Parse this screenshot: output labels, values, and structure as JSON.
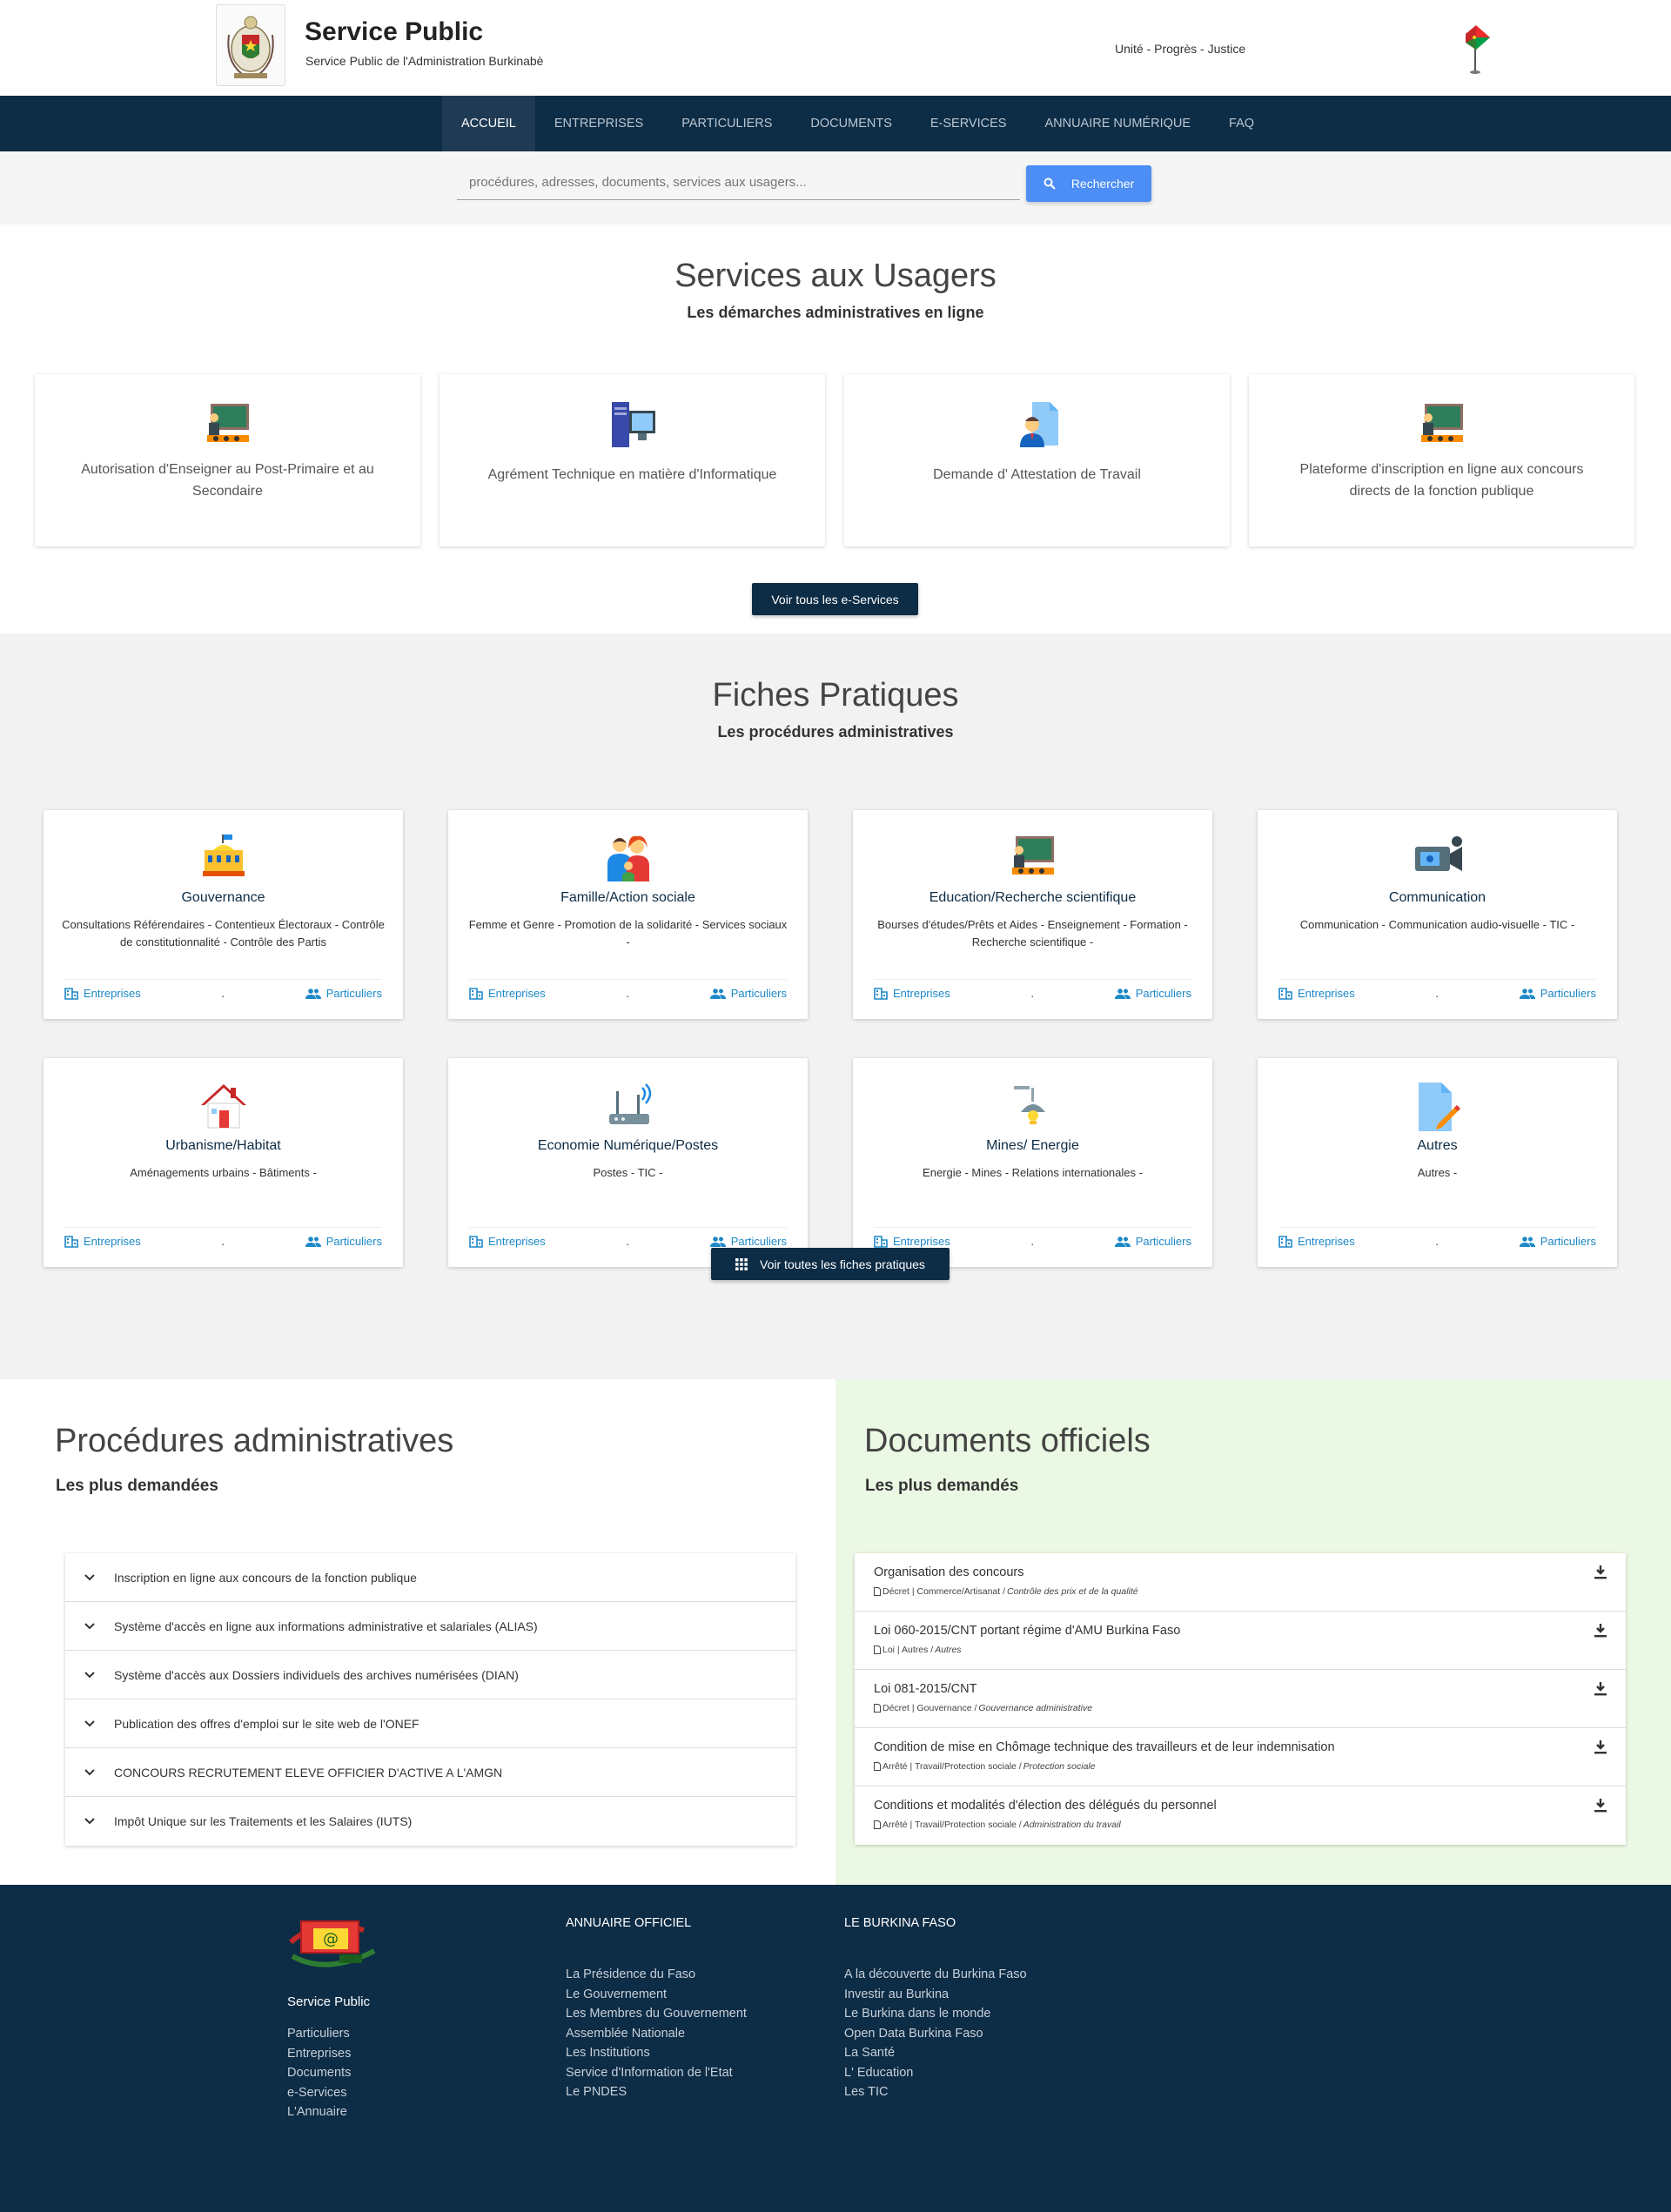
{
  "header": {
    "title": "Service Public",
    "subtitle": "Service Public de l'Administration Burkinabè",
    "motto": "Unité - Progrès - Justice"
  },
  "nav": {
    "items": [
      "ACCUEIL",
      "ENTREPRISES",
      "PARTICULIERS",
      "DOCUMENTS",
      "E-SERVICES",
      "ANNUAIRE NUMÉRIQUE",
      "FAQ"
    ],
    "active": "ACCUEIL"
  },
  "search": {
    "placeholder": "procédures, adresses, documents, services aux usagers...",
    "button": "Rechercher"
  },
  "services": {
    "title": "Services aux Usagers",
    "subtitle": "Les démarches administratives en ligne",
    "cards": [
      {
        "label": "Autorisation d'Enseigner au Post-Primaire et au Secondaire",
        "icon": "teacher-board-icon"
      },
      {
        "label": "Agrément Technique en matière d'Informatique",
        "icon": "computer-icon"
      },
      {
        "label": "Demande d' Attestation de Travail",
        "icon": "employee-document-icon"
      },
      {
        "label": "Plateforme d'inscription en ligne aux concours directs de la fonction publique",
        "icon": "teacher-board-icon"
      }
    ],
    "more_button": "Voir tous les e-Services"
  },
  "fiches": {
    "title": "Fiches Pratiques",
    "subtitle": "Les procédures administratives",
    "entreprises_label": "Entreprises",
    "particuliers_label": "Particuliers",
    "separator": ".",
    "cards": [
      {
        "title": "Gouvernance",
        "desc": "Consultations Référendaires - Contentieux Électoraux - Contrôle de constitutionnalité - Contrôle des Partis",
        "icon": "government-building-icon"
      },
      {
        "title": "Famille/Action sociale",
        "desc": "Femme et Genre - Promotion de la solidarité - Services sociaux -",
        "icon": "family-icon"
      },
      {
        "title": "Education/Recherche scientifique",
        "desc": "Bourses d'études/Prêts et Aides - Enseignement - Formation - Recherche scientifique -",
        "icon": "teacher-board-icon"
      },
      {
        "title": "Communication",
        "desc": "Communication - Communication audio-visuelle - TIC -",
        "icon": "video-camera-icon"
      },
      {
        "title": "Urbanisme/Habitat",
        "desc": "Aménagements urbains - Bâtiments -",
        "icon": "house-icon"
      },
      {
        "title": "Economie Numérique/Postes",
        "desc": "Postes - TIC -",
        "icon": "router-icon"
      },
      {
        "title": "Mines/ Energie",
        "desc": "Energie - Mines - Relations internationales -",
        "icon": "lamp-icon"
      },
      {
        "title": "Autres",
        "desc": "Autres -",
        "icon": "document-pencil-icon"
      }
    ],
    "more_button": "Voir toutes les fiches pratiques"
  },
  "procedures": {
    "title": "Procédures administratives",
    "subtitle": "Les plus demandées",
    "items": [
      "Inscription en ligne aux concours de la fonction publique",
      "Système d'accès en ligne aux informations administrative et salariales (ALIAS)",
      "Système d'accès aux Dossiers individuels des archives numérisées (DIAN)",
      "Publication des offres d'emploi sur le site web de l'ONEF",
      "CONCOURS RECRUTEMENT ELEVE OFFICIER D'ACTIVE A L'AMGN",
      "Impôt Unique sur les Traitements et les Salaires (IUTS)"
    ]
  },
  "documents": {
    "title": "Documents officiels",
    "subtitle": "Les plus demandés",
    "items": [
      {
        "title": "Organisation des concours",
        "meta": "Décret | Commerce/Artisanat / ",
        "meta_italic": "Contrôle des prix et de la qualité"
      },
      {
        "title": "Loi 060-2015/CNT portant régime d'AMU Burkina Faso",
        "meta": "Loi | Autres / ",
        "meta_italic": "Autres"
      },
      {
        "title": "Loi 081-2015/CNT",
        "meta": "Décret | Gouvernance / ",
        "meta_italic": "Gouvernance administrative"
      },
      {
        "title": "Condition de mise en Chômage technique des travailleurs et de leur indemnisation",
        "meta": "Arrêté | Travail/Protection sociale / ",
        "meta_italic": "Protection sociale"
      },
      {
        "title": "Conditions et modalités d'élection des délégués du personnel",
        "meta": "Arrêté | Travail/Protection sociale / ",
        "meta_italic": "Administration du travail"
      }
    ]
  },
  "footer": {
    "name": "Service Public",
    "links": [
      "Particuliers",
      "Entreprises",
      "Documents",
      "e-Services",
      "L'Annuaire"
    ],
    "annuaire": {
      "title": "ANNUAIRE OFFICIEL",
      "links": [
        "La Présidence du Faso",
        "Le Gouvernement",
        "Les Membres du Gouvernement",
        "Assemblée Nationale",
        "Les Institutions",
        "Service d'Information de l'Etat",
        "Le PNDES"
      ]
    },
    "burkina": {
      "title": "LE BURKINA FASO",
      "links": [
        "A la découverte du Burkina Faso",
        "Investir au Burkina",
        "Le Burkina dans le monde",
        "Open Data Burkina Faso",
        "La Santé",
        "L' Education",
        "Les TIC"
      ]
    }
  },
  "colors": {
    "navy": "#0d2c45",
    "accent_blue": "#4c8df6",
    "link_blue": "#1e88c7",
    "docs_bg": "#ebf8e3",
    "fiches_bg": "#f2f2f2"
  }
}
